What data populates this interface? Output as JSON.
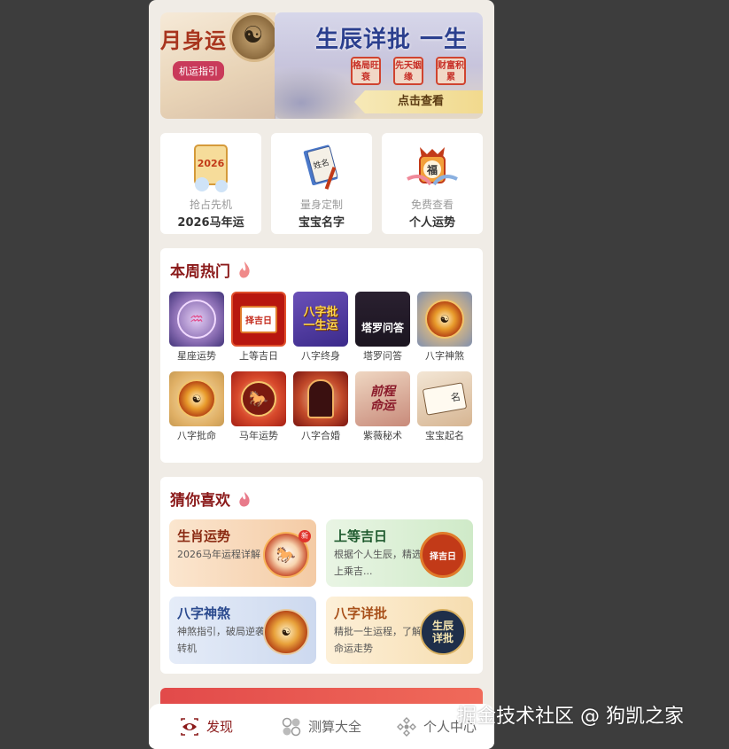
{
  "banner": {
    "left_title": "月身运",
    "left_pill": "机运指引",
    "right_title": "生辰详批 一生",
    "right_tags": [
      "格局旺衰",
      "先天姻缘",
      "财富积累"
    ],
    "right_button": "点击查看"
  },
  "features": [
    {
      "sub": "抢占先机",
      "title": "2026马年运",
      "icon": "scroll-2026-icon",
      "badge": "2026"
    },
    {
      "sub": "量身定制",
      "title": "宝宝名字",
      "icon": "name-book-icon",
      "badge": "姓名"
    },
    {
      "sub": "免费查看",
      "title": "个人运势",
      "icon": "fortune-lantern-icon",
      "badge": "福"
    }
  ],
  "hot": {
    "title": "本周热门",
    "items": [
      {
        "label": "星座运势",
        "icon": "zodiac-wheel-icon",
        "art": "♒"
      },
      {
        "label": "上等吉日",
        "icon": "calendar-icon",
        "art": "择吉日"
      },
      {
        "label": "八字终身",
        "icon": "bazi-lifetime-icon",
        "art": "八字批\n一生运"
      },
      {
        "label": "塔罗问答",
        "icon": "tarot-icon",
        "art": "塔罗问答"
      },
      {
        "label": "八字神煞",
        "icon": "bagua-wheel-icon",
        "art": "☯"
      },
      {
        "label": "八字批命",
        "icon": "bagua-wheel-icon",
        "art": "☯"
      },
      {
        "label": "马年运势",
        "icon": "horse-icon",
        "art": "🐎"
      },
      {
        "label": "八字合婚",
        "icon": "couple-icon",
        "art": ""
      },
      {
        "label": "紫薇秘术",
        "icon": "ziwei-icon",
        "art": "前程\n命运"
      },
      {
        "label": "宝宝起名",
        "icon": "baby-name-book-icon",
        "art": "名"
      }
    ]
  },
  "guess": {
    "title": "猜你喜欢",
    "cards": [
      {
        "title": "生肖运势",
        "desc": "2026马年运程详解",
        "badge": "新",
        "icon": "zodiac-horse-icon",
        "art": "🐎"
      },
      {
        "title": "上等吉日",
        "desc": "根据个人生辰，精选上乘吉...",
        "icon": "calendar-icon",
        "art": "择吉日"
      },
      {
        "title": "八字神煞",
        "desc": "神煞指引，破局逆袭转机",
        "icon": "bagua-wheel-icon",
        "art": "☯"
      },
      {
        "title": "八字详批",
        "desc": "精批一生运程，了解命运走势",
        "icon": "bazi-detail-icon",
        "art": "生辰\n详批"
      }
    ]
  },
  "tabs": [
    {
      "label": "发现",
      "icon": "eye-icon",
      "active": true
    },
    {
      "label": "测算大全",
      "icon": "grid-icon",
      "active": false
    },
    {
      "label": "个人中心",
      "icon": "user-icon",
      "active": false
    }
  ],
  "watermark": "掘金技术社区 @ 狗凯之家",
  "colors": {
    "accent": "#8b1a1a",
    "page_bg": "#f0ece6",
    "outer_bg": "#3d3d3d"
  }
}
